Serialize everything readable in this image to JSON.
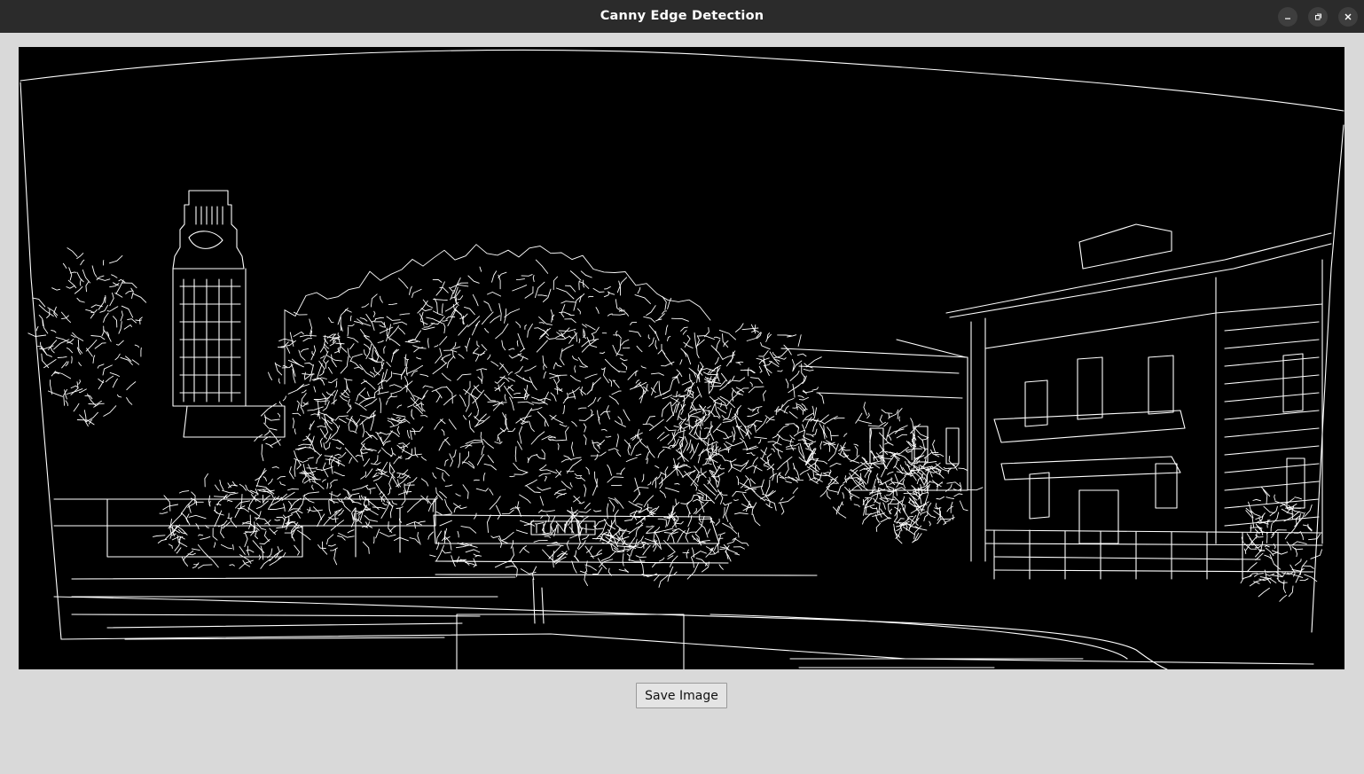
{
  "window": {
    "title": "Canny Edge Detection",
    "controls": [
      "minimize-icon",
      "maximize-icon",
      "close-icon"
    ]
  },
  "image": {
    "content": "canny-edge-map",
    "background_color": "#000000",
    "edge_color": "#ffffff"
  },
  "actions": {
    "save_label": "Save Image"
  },
  "colors": {
    "titlebar": "#2b2b2b",
    "window_bg": "#d9d9d9",
    "button_bg": "#e4e4e4"
  }
}
